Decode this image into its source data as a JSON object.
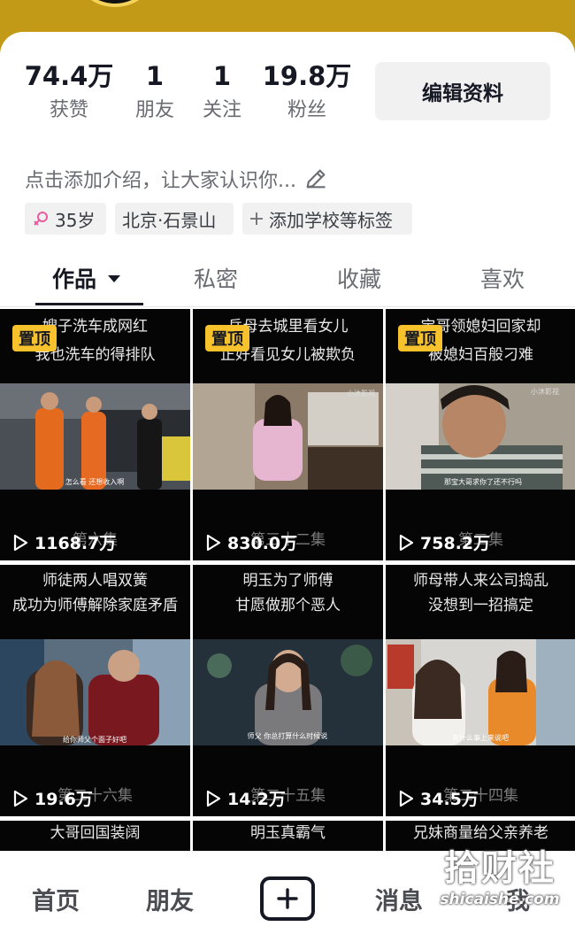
{
  "stats": [
    {
      "value": "74.4万",
      "label": "获赞"
    },
    {
      "value": "1",
      "label": "朋友"
    },
    {
      "value": "1",
      "label": "关注"
    },
    {
      "value": "19.8万",
      "label": "粉丝"
    }
  ],
  "edit_profile_label": "编辑资料",
  "bio_placeholder": "点击添加介绍，让大家认识你...",
  "tags": {
    "age": "35岁",
    "location": "北京·石景山",
    "add_school": "添加学校等标签"
  },
  "tabs": {
    "works": "作品",
    "private": "私密",
    "collections": "收藏",
    "likes": "喜欢"
  },
  "videos": [
    {
      "caption": [
        "嫂子洗车成网红",
        "我也洗车的得排队"
      ],
      "pinned": true,
      "pin_label": "置顶",
      "episode": "第六集",
      "plays": "1168.7万",
      "subtitle": "怎么看 还想收入啊"
    },
    {
      "caption": [
        "岳母去城里看女儿",
        "正好看见女儿被欺负"
      ],
      "pinned": true,
      "pin_label": "置顶",
      "episode": "第三十二集",
      "plays": "830.0万",
      "subtitle": ""
    },
    {
      "caption": [
        "宝哥领媳妇回家却",
        "被媳妇百般刁难"
      ],
      "pinned": true,
      "pin_label": "置顶",
      "episode": "第二集",
      "plays": "758.2万",
      "subtitle": "那宝大哥求你了还不行吗"
    },
    {
      "caption": [
        "师徒两人唱双簧",
        "成功为师傅解除家庭矛盾"
      ],
      "pinned": false,
      "pin_label": "",
      "episode": "第二十六集",
      "plays": "19.6万",
      "subtitle": "给你师父个面子好吧"
    },
    {
      "caption": [
        "明玉为了师傅",
        "甘愿做那个恶人"
      ],
      "pinned": false,
      "pin_label": "",
      "episode": "第二十五集",
      "plays": "14.2万",
      "subtitle": "师父 你总打算什么时候说"
    },
    {
      "caption": [
        "师母带人来公司捣乱",
        "没想到一招搞定"
      ],
      "pinned": false,
      "pin_label": "",
      "episode": "第二十四集",
      "plays": "34.5万",
      "subtitle": "有什么事上来说吧"
    },
    {
      "caption": [
        "大哥回国装阔"
      ],
      "pinned": false,
      "pin_label": "",
      "episode": "",
      "plays": "",
      "subtitle": ""
    },
    {
      "caption": [
        "明玉真霸气"
      ],
      "pinned": false,
      "pin_label": "",
      "episode": "",
      "plays": "",
      "subtitle": ""
    },
    {
      "caption": [
        "兄妹商量给父亲养老"
      ],
      "pinned": false,
      "pin_label": "",
      "episode": "",
      "plays": "",
      "subtitle": ""
    }
  ],
  "channel_watermark": "小沐影视",
  "bottom_nav": {
    "home": "首页",
    "friends": "朋友",
    "messages": "消息",
    "me": "我"
  },
  "site_watermark": {
    "cn": "拾财社",
    "en": "shicaishe.com"
  },
  "colors": {
    "banner": "#c29a18",
    "pin_badge": "#f7c22c",
    "tag_bg": "#f1f1f2"
  }
}
